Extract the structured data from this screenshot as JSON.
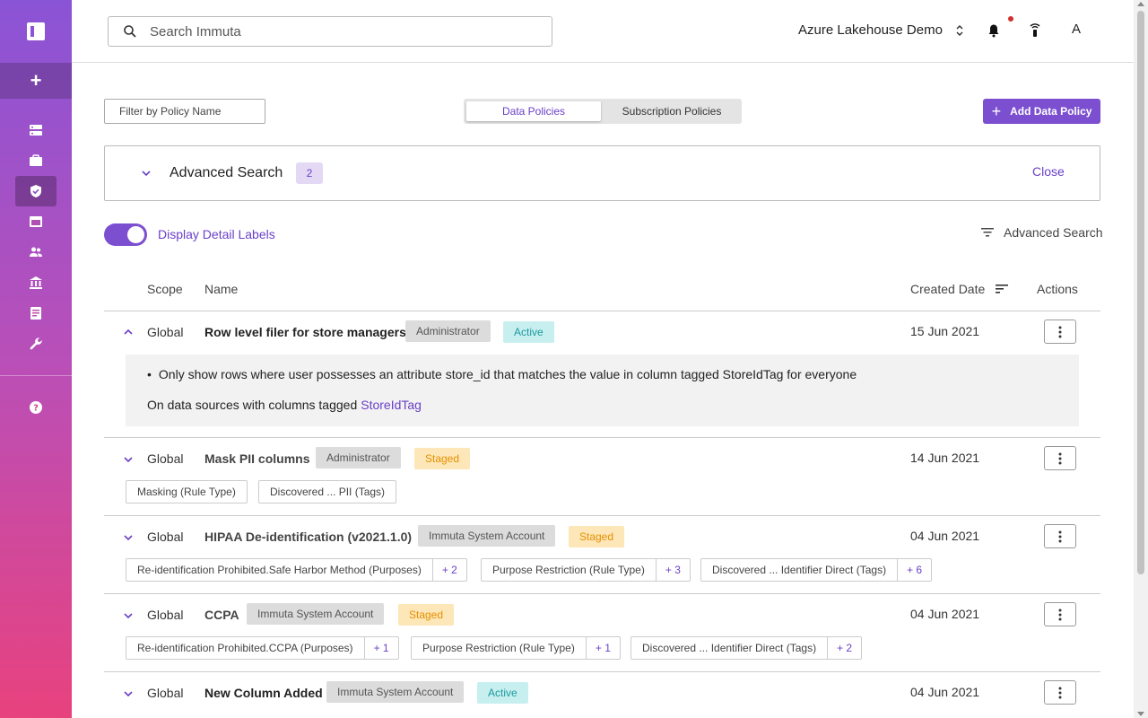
{
  "topbar": {
    "search_placeholder": "Search Immuta",
    "tenant": "Azure Lakehouse Demo",
    "avatar": "A"
  },
  "toolbar": {
    "filter_placeholder": "Filter by Policy Name",
    "tab_data": "Data Policies",
    "tab_subscription": "Subscription Policies",
    "add_label": "Add Data Policy"
  },
  "advanced_panel": {
    "title": "Advanced Search",
    "count": "2",
    "close": "Close"
  },
  "toggle": {
    "label": "Display Detail Labels",
    "on": true
  },
  "advanced_link": "Advanced Search",
  "table": {
    "headers": {
      "scope": "Scope",
      "name": "Name",
      "created": "Created Date",
      "actions": "Actions"
    },
    "rows": [
      {
        "scope": "Global",
        "name": "Row level filer for store managers",
        "author": "Administrator",
        "status": "Active",
        "date": "15 Jun 2021",
        "detail": "Only show rows where user possesses an attribute store_id that matches the value in column tagged StoreIdTag for everyone",
        "datasources_prefix": "On data sources with columns tagged",
        "datasources_tag": "StoreIdTag"
      },
      {
        "scope": "Global",
        "name": "Mask PII columns",
        "author": "Administrator",
        "status": "Staged",
        "date": "14 Jun 2021",
        "chips": [
          {
            "text": "Masking (Rule Type)"
          },
          {
            "text": "Discovered ... PII (Tags)"
          }
        ]
      },
      {
        "scope": "Global",
        "name": "HIPAA De-identification (v2021.1.0)",
        "author": "Immuta System Account",
        "status": "Staged",
        "date": "04 Jun 2021",
        "chips": [
          {
            "text": "Re-identification Prohibited.Safe Harbor Method (Purposes)",
            "more": "+ 2"
          },
          {
            "text": "Purpose Restriction (Rule Type)",
            "more": "+ 3"
          },
          {
            "text": "Discovered ... Identifier Direct (Tags)",
            "more": "+ 6"
          }
        ]
      },
      {
        "scope": "Global",
        "name": "CCPA",
        "author": "Immuta System Account",
        "status": "Staged",
        "date": "04 Jun 2021",
        "chips": [
          {
            "text": "Re-identification Prohibited.CCPA (Purposes)",
            "more": "+ 1"
          },
          {
            "text": "Purpose Restriction (Rule Type)",
            "more": "+ 1"
          },
          {
            "text": "Discovered ... Identifier Direct (Tags)",
            "more": "+ 2"
          }
        ]
      },
      {
        "scope": "Global",
        "name": "New Column Added",
        "author": "Immuta System Account",
        "status": "Active",
        "date": "04 Jun 2021"
      }
    ]
  },
  "colors": {
    "accent": "#7c4fd0",
    "active": "#1b9aa0",
    "staged": "#e69000"
  }
}
